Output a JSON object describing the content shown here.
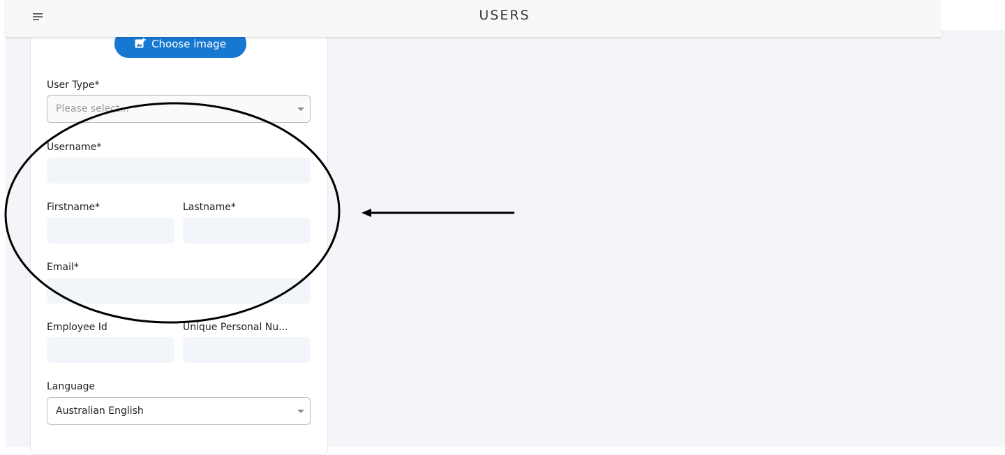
{
  "header": {
    "title": "USERS",
    "menu_icon": "hamburger-menu-icon"
  },
  "form": {
    "choose_image": {
      "label": "Choose image",
      "icon": "add-image-icon"
    },
    "user_type": {
      "label": "User Type*",
      "placeholder": "Please select..."
    },
    "username": {
      "label": "Username*",
      "value": ""
    },
    "firstname": {
      "label": "Firstname*",
      "value": ""
    },
    "lastname": {
      "label": "Lastname*",
      "value": ""
    },
    "email": {
      "label": "Email*",
      "value": ""
    },
    "employee_id": {
      "label": "Employee Id",
      "value": ""
    },
    "unique_personal_number": {
      "label": "Unique Personal Nu...",
      "value": ""
    },
    "language": {
      "label": "Language",
      "selected": "Australian English"
    }
  },
  "colors": {
    "accent": "#1778d2",
    "page_background": "#f3f5f9",
    "input_background": "#f2f6fb",
    "annotation": "#000000"
  }
}
